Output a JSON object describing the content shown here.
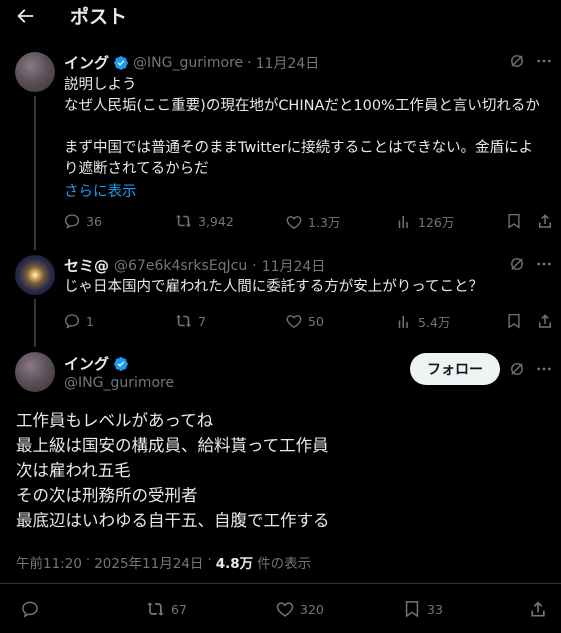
{
  "header": {
    "title": "ポスト",
    "back_icon": "arrow-left-icon"
  },
  "tweet1": {
    "name": "イング",
    "handle": "@ING_gurimore",
    "dot": "·",
    "date": "11月24日",
    "lines": [
      "説明しよう",
      "なぜ人民垢(ここ重要)の現在地がCHINAだと100%工作員と言い切れるか",
      "",
      "まず中国では普通そのままTwitterに接続することはできない。金盾によ",
      "り遮断されてるからだ"
    ],
    "show_more": "さらに表示",
    "stats": {
      "replies": "36",
      "reposts": "3,942",
      "likes": "1.3万",
      "views": "126万"
    }
  },
  "tweet2": {
    "name": "セミ@",
    "handle": "@67e6k4srksEqJcu",
    "dot": "·",
    "date": "11月24日",
    "text": "じゃ日本国内で雇われた人間に委託する方が安上がりってこと？",
    "stats": {
      "replies": "1",
      "reposts": "7",
      "likes": "50",
      "views": "5.4万"
    }
  },
  "main": {
    "name": "イング",
    "handle": "@ING_gurimore",
    "follow_label": "フォロー",
    "lines": [
      "工作員もレベルがあってね",
      "最上級は国安の構成員、給料貰って工作員",
      "次は雇われ五毛",
      "その次は刑務所の受刑者",
      "最底辺はいわゆる自干五、自腹で工作する"
    ],
    "time": "午前11:20",
    "dot": "·",
    "date": "2025年11月24日",
    "views_count": "4.8万",
    "views_label": "件の表示",
    "stats": {
      "reposts": "67",
      "likes": "320",
      "bookmarks": "33"
    }
  },
  "colors": {
    "accent": "#1d9bf0",
    "muted": "#71767b",
    "text": "#e7e9ea",
    "background": "#000000"
  }
}
